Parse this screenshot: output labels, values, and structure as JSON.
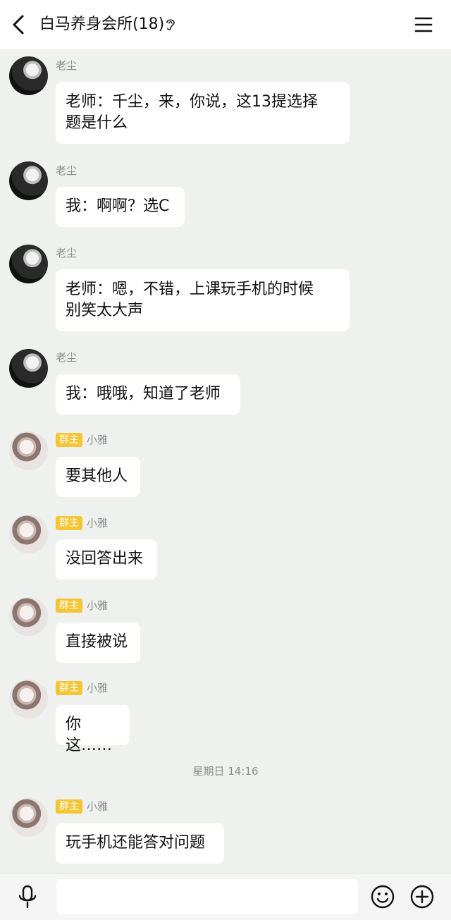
{
  "header": {
    "title": "白马养身会所(18)",
    "icons": {
      "back": "chevron-left-icon",
      "ear": "ear-icon",
      "menu": "hamburger-menu-icon"
    }
  },
  "badges": {
    "owner": "群主"
  },
  "messages": [
    {
      "sender": "老尘",
      "badge": "",
      "lines": [
        "老师：千尘，来，你说，这13提选择",
        "题是什么"
      ]
    },
    {
      "sender": "老尘",
      "badge": "",
      "lines": [
        "我：啊啊？选C"
      ]
    },
    {
      "sender": "老尘",
      "badge": "",
      "lines": [
        "老师：嗯，不错，上课玩手机的时候",
        "别笑太大声"
      ]
    },
    {
      "sender": "老尘",
      "badge": "",
      "lines": [
        "我：哦哦，知道了老师"
      ]
    },
    {
      "sender": "小雅",
      "badge": "群主",
      "lines": [
        "要其他人"
      ]
    },
    {
      "sender": "小雅",
      "badge": "群主",
      "lines": [
        "没回答出来"
      ]
    },
    {
      "sender": "小雅",
      "badge": "群主",
      "lines": [
        "直接被说"
      ]
    },
    {
      "sender": "小雅",
      "badge": "群主",
      "lines": [
        "你这……"
      ]
    },
    {
      "sender": "小雅",
      "badge": "群主",
      "lines": [
        "玩手机还能答对问题"
      ]
    }
  ],
  "timestamp": "星期日 14:16",
  "input": {
    "value": "",
    "placeholder": ""
  },
  "bottom_icons": {
    "voice": "microphone-icon",
    "emoji": "smiley-icon",
    "more": "plus-circle-icon"
  },
  "colors": {
    "background": "#eef1ed",
    "bubble": "#ffffff",
    "badge": "#f6c534",
    "meta_text": "#8d8d8d"
  }
}
